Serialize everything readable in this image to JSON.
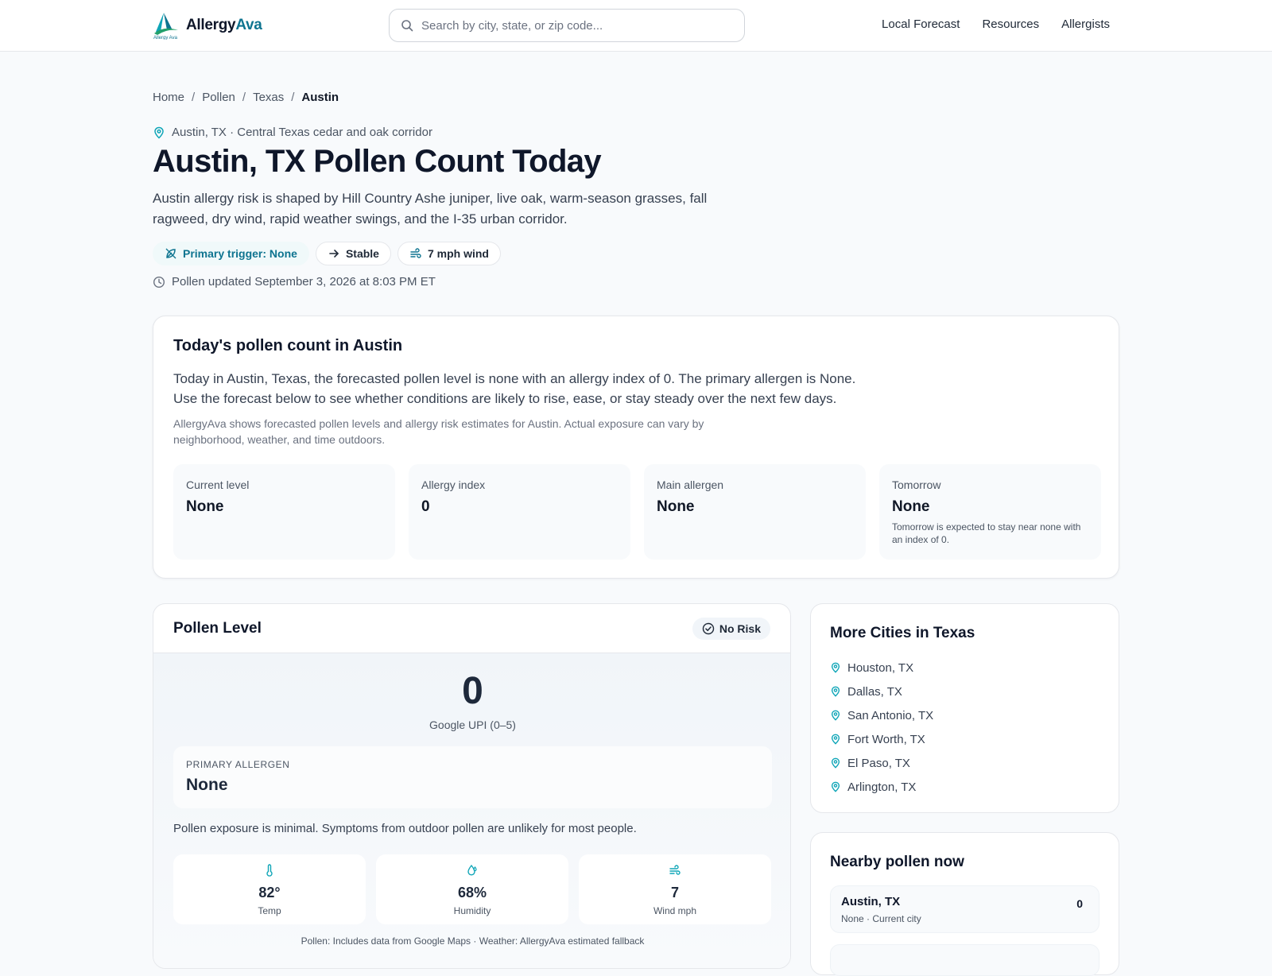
{
  "header": {
    "logo_main": "Allergy",
    "logo_accent": "Ava",
    "search_placeholder": "Search by city, state, or zip code...",
    "nav": [
      "Local Forecast",
      "Resources",
      "Allergists"
    ]
  },
  "breadcrumb": [
    "Home",
    "Pollen",
    "Texas",
    "Austin"
  ],
  "hero": {
    "location_line": "Austin, TX · Central Texas cedar and oak corridor",
    "title": "Austin, TX Pollen Count Today",
    "intro": "Austin allergy risk is shaped by Hill Country Ashe juniper, live oak, warm-season grasses, fall ragweed, dry wind, rapid weather swings, and the I-35 urban corridor.",
    "chips": {
      "trigger": "Primary trigger: None",
      "trend": "Stable",
      "wind": "7 mph wind"
    },
    "updated": "Pollen updated September 3, 2026 at 8:03 PM ET"
  },
  "today": {
    "heading": "Today's pollen count in Austin",
    "lead": "Today in Austin, Texas, the forecasted pollen level is none with an allergy index of 0. The primary allergen is None. Use the forecast below to see whether conditions are likely to rise, ease, or stay steady over the next few days.",
    "note": "AllergyAva shows forecasted pollen levels and allergy risk estimates for Austin. Actual exposure can vary by neighborhood, weather, and time outdoors.",
    "stats": [
      {
        "label": "Current level",
        "value": "None",
        "sub": ""
      },
      {
        "label": "Allergy index",
        "value": "0",
        "sub": ""
      },
      {
        "label": "Main allergen",
        "value": "None",
        "sub": ""
      },
      {
        "label": "Tomorrow",
        "value": "None",
        "sub": "Tomorrow is expected to stay near none with an index of 0."
      }
    ]
  },
  "pollen_level": {
    "heading": "Pollen Level",
    "badge": "No Risk",
    "index_value": "0",
    "index_caption": "Google UPI (0–5)",
    "allergen_label": "PRIMARY ALLERGEN",
    "allergen_value": "None",
    "exposure_text": "Pollen exposure is minimal. Symptoms from outdoor pollen are unlikely for most people.",
    "weather": [
      {
        "icon": "thermometer-icon",
        "value": "82°",
        "label": "Temp"
      },
      {
        "icon": "humidity-icon",
        "value": "68%",
        "label": "Humidity"
      },
      {
        "icon": "wind-icon",
        "value": "7",
        "label": "Wind mph"
      }
    ],
    "source": "Pollen: Includes data from Google Maps · Weather: AllergyAva estimated fallback"
  },
  "more_cities": {
    "heading": "More Cities in Texas",
    "cities": [
      "Houston, TX",
      "Dallas, TX",
      "San Antonio, TX",
      "Fort Worth, TX",
      "El Paso, TX",
      "Arlington, TX"
    ]
  },
  "nearby": {
    "heading": "Nearby pollen now",
    "rows": [
      {
        "name": "Austin, TX",
        "meta": "None · Current city",
        "value": "0"
      }
    ]
  },
  "colors": {
    "accent": "#0e7490",
    "pin": "#0ea5b7",
    "logo_green": "#22a06b"
  }
}
